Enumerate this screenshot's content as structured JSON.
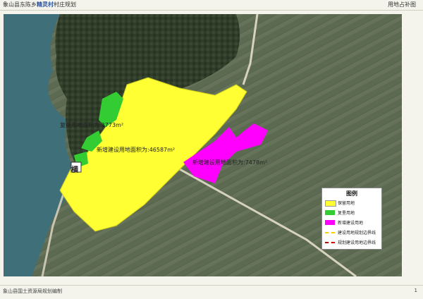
{
  "header": {
    "title_part1": "象山县东陈乡",
    "title_highlight": "精灵村",
    "title_part2": "村庄规划",
    "right_title": "用地占补图"
  },
  "map": {
    "labels": {
      "green_area": "复垦用地面积为:3773m²",
      "yellow_area": "新增建设用地面积为:46587m²",
      "magenta_area": "新增建设用地面积为:7478m²",
      "village_marker": "横"
    }
  },
  "legend": {
    "title": "图例",
    "items": [
      {
        "label": "保留用地",
        "color": "#ffff33"
      },
      {
        "label": "复垦用地",
        "color": "#33cc33"
      },
      {
        "label": "新增建设用地",
        "color": "#ff00ff"
      },
      {
        "label": "建设用地规划边界线",
        "color": "#ffcc00",
        "style": "dashed"
      },
      {
        "label": "规划建设用地边界线",
        "color": "#cc0000",
        "style": "dashed"
      }
    ]
  },
  "footer": {
    "text": "象山县国土资源局规划编制",
    "mark": "1"
  }
}
